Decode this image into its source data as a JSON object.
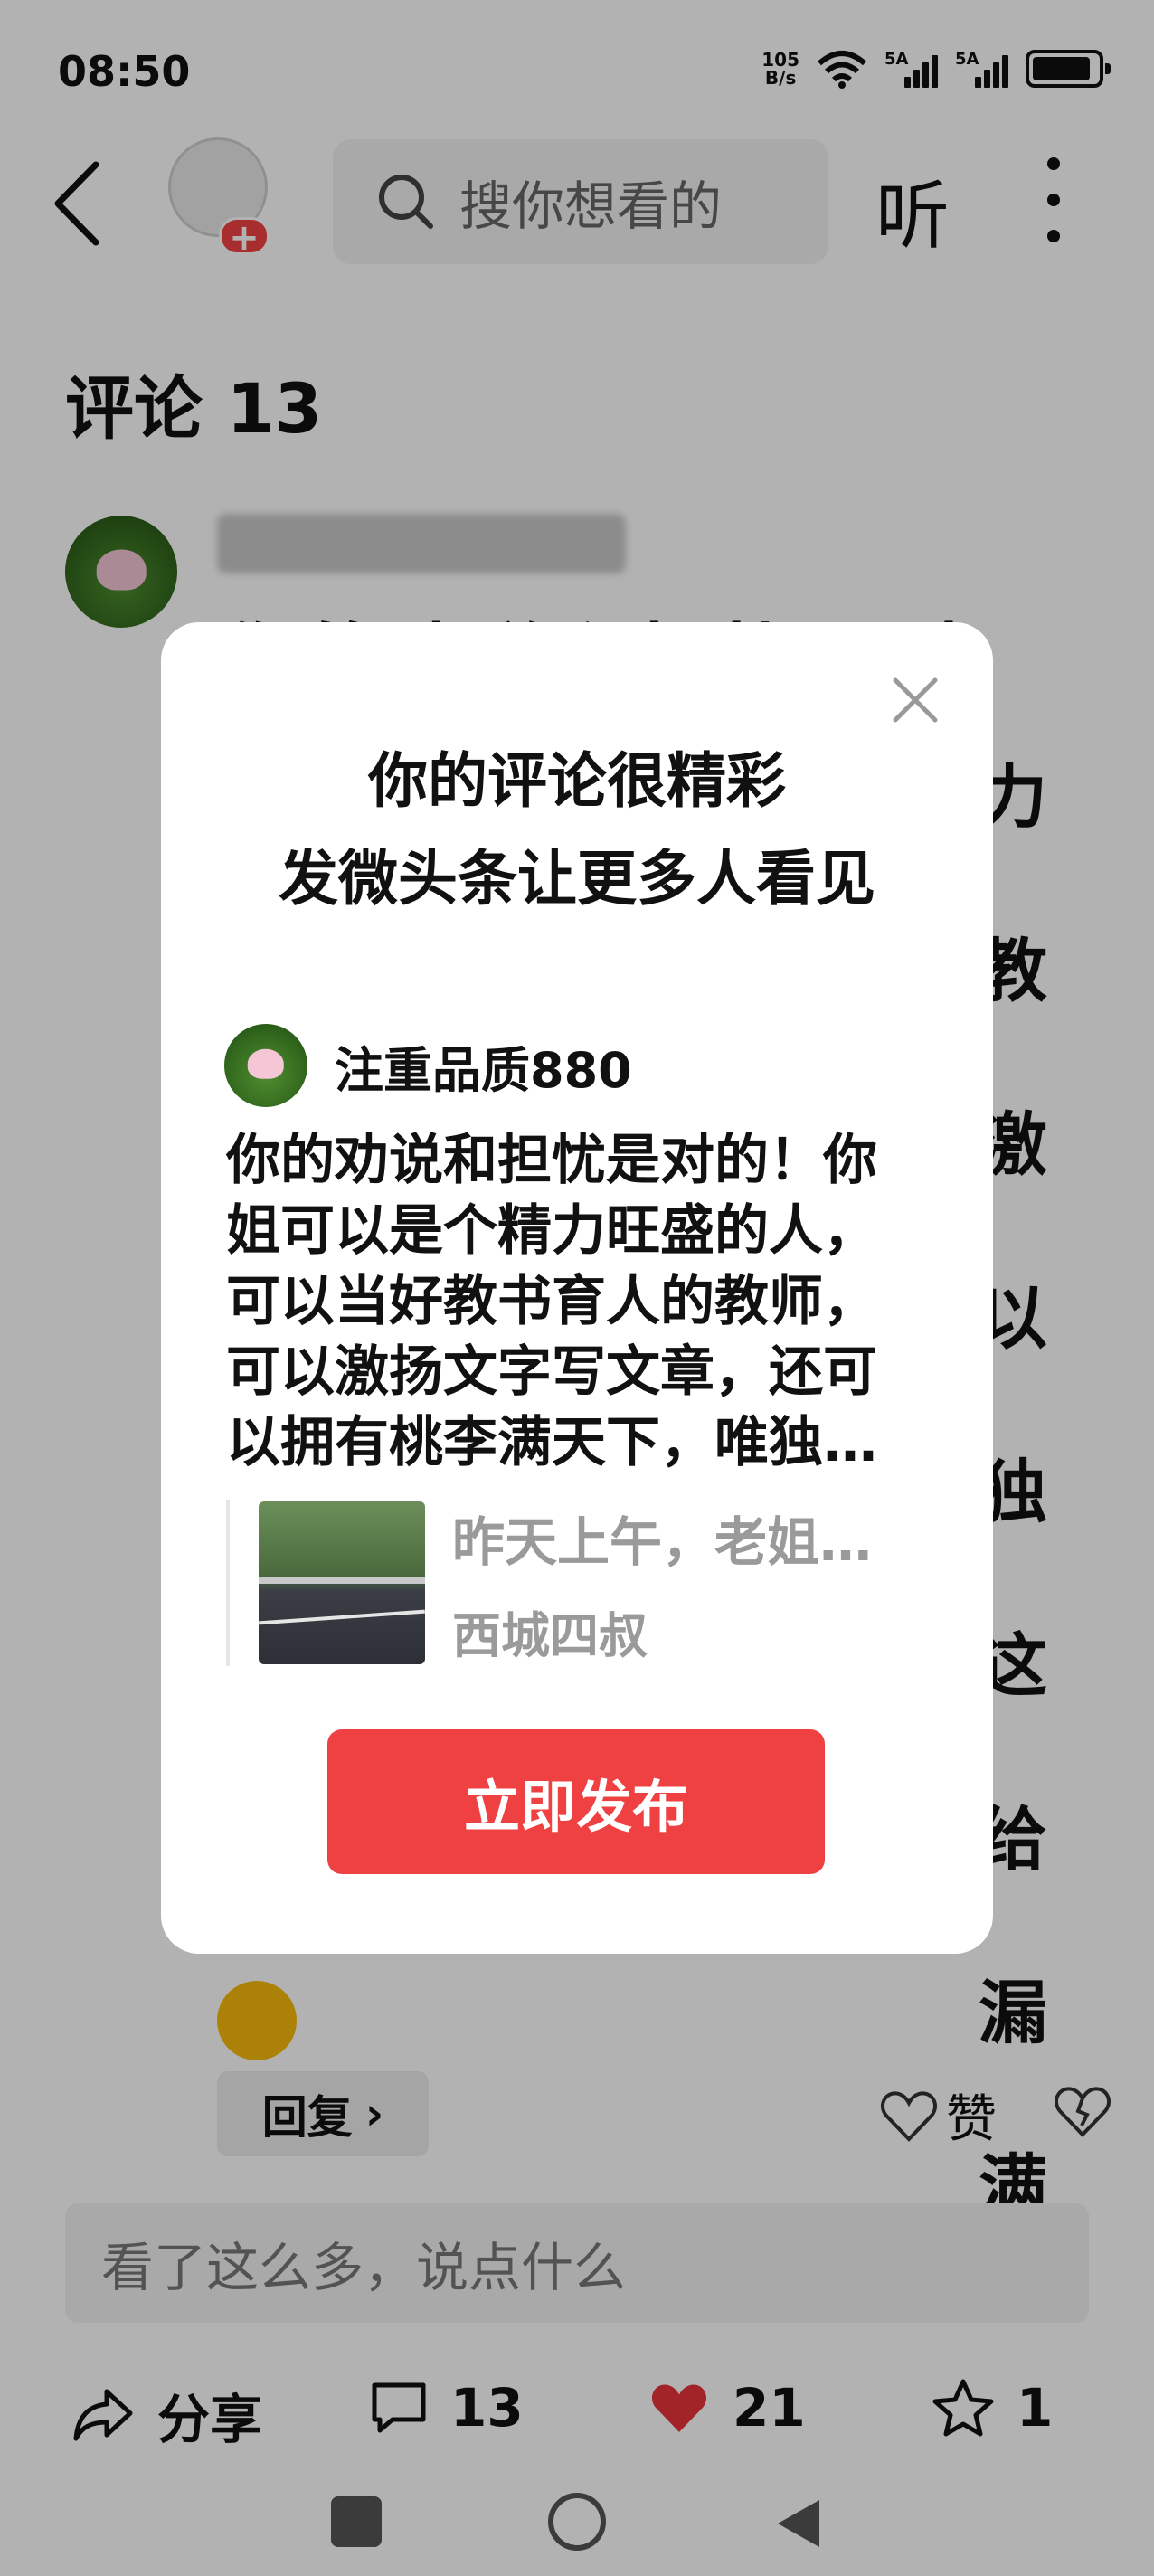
{
  "status_bar": {
    "time": "08:50",
    "net_speed_value": "105",
    "net_speed_unit": "B/s",
    "sim1": "5A",
    "sim2": "5A",
    "battery_level": 0.9
  },
  "top_bar": {
    "search_placeholder": "搜你想看的",
    "listen_label": "听"
  },
  "comments": {
    "header": "评论 13",
    "first_comment_partial": "你的劝说和担忧是对",
    "right_column_chars": [
      "力",
      "教",
      "激",
      "以",
      "独",
      "这",
      "给",
      "漏",
      "满"
    ],
    "reply_label": "回复",
    "reply_chevron": "›",
    "like_label": "赞",
    "input_placeholder": "看了这么多，说点什么"
  },
  "bottom_bar": {
    "share_label": "分享",
    "comments_count": "13",
    "likes_count": "21",
    "favorites_count": "1",
    "like_color": "#e8343a"
  },
  "dialog": {
    "title_line1": "你的评论很精彩",
    "title_line2": "发微头条让更多人看见",
    "username": "注重品质880",
    "comment_lines": [
      "你的劝说和担忧是对的！你",
      "姐可以是个精力旺盛的人，",
      "可以当好教书育人的教师，",
      "可以激扬文字写文章，还可",
      "以拥有桃李满天下，唯独…"
    ],
    "quote_title": "昨天上午，老姐…",
    "quote_author": "西城四叔",
    "publish_label": "立即发布",
    "accent_color": "#f04142"
  }
}
